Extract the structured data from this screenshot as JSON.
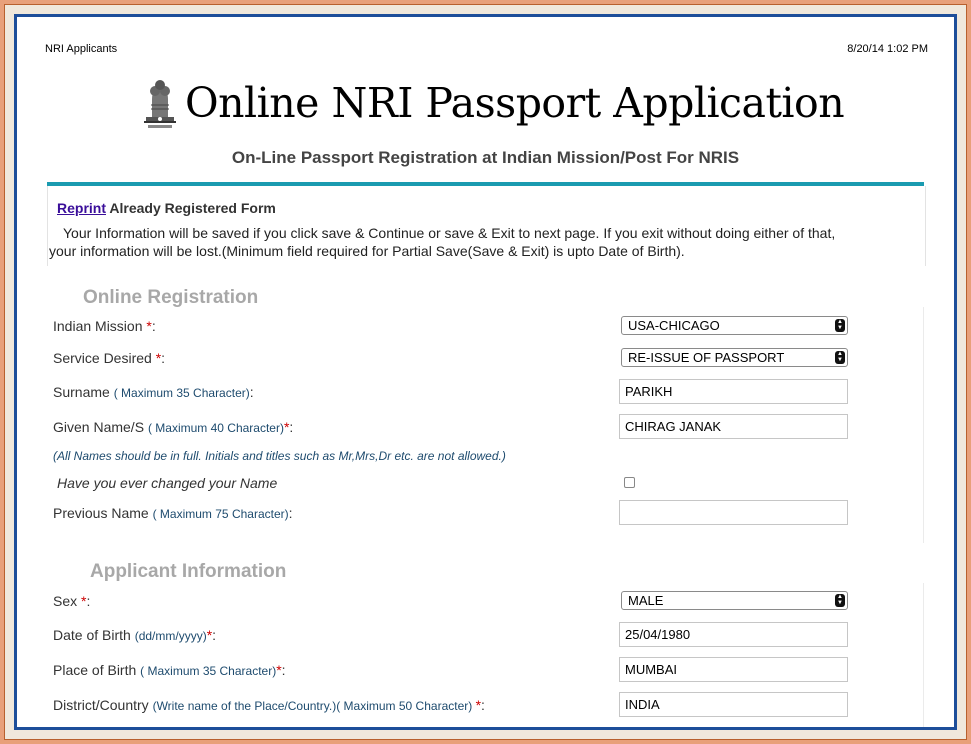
{
  "header": {
    "left": "NRI  Applicants",
    "right": "8/20/14 1:02 PM"
  },
  "title": "Online NRI Passport Application",
  "subtitle": "On-Line Passport Registration at Indian Mission/Post For NRIS",
  "reprint": {
    "link": "Reprint",
    "text": "Already Registered Form"
  },
  "info": {
    "line1": "Your Information will be saved if you click save & Continue or save & Exit to next page. If you exit without  doing either of that,",
    "line2": "your information will be lost.(Minimum field required for Partial Save(Save & Exit) is upto  Date of Birth)."
  },
  "online_registration": {
    "heading": "Online Registration",
    "indian_mission": {
      "label": "Indian Mission ",
      "req": "*",
      "suffix": ":",
      "value": "USA-CHICAGO"
    },
    "service_desired": {
      "label": "Service Desired ",
      "req": "*",
      "suffix": ":",
      "value": "RE-ISSUE OF PASSPORT"
    },
    "surname": {
      "label": "Surname ",
      "hint": "( Maximum 35 Character)",
      "suffix": ":",
      "value": "PARIKH"
    },
    "given_name": {
      "label": "Given Name/S ",
      "hint": "( Maximum 40 Character)",
      "req": "*",
      "suffix": ":",
      "value": "CHIRAG JANAK"
    },
    "note": "(All Names should be in full. Initials and titles such as Mr,Mrs,Dr etc. are not allowed.)",
    "changed_name": {
      "label": "Have you ever changed your Name",
      "checked": false
    },
    "previous_name": {
      "label": "Previous Name ",
      "hint": "( Maximum 75 Character)",
      "suffix": ":",
      "value": ""
    }
  },
  "applicant_information": {
    "heading": "Applicant Information",
    "sex": {
      "label": "Sex ",
      "req": "*",
      "suffix": ":",
      "value": "MALE"
    },
    "dob": {
      "label": "Date of Birth ",
      "hint": "(dd/mm/yyyy)",
      "req": "*",
      "suffix": ":",
      "value": "25/04/1980"
    },
    "place_of_birth": {
      "label": "Place of Birth ",
      "hint": "( Maximum 35 Character)",
      "req": "*",
      "suffix": ":",
      "value": "MUMBAI"
    },
    "district_country": {
      "label": "District/Country ",
      "hint": "(Write name of the Place/Country.)( Maximum 50 Character) ",
      "req": "*",
      "suffix": ":",
      "value": "INDIA"
    }
  },
  "colors": {
    "accent_teal": "#1a9bb0",
    "frame_blue": "#1d4e9a",
    "link_purple": "#3a0e9a",
    "required_red": "#cc0000"
  }
}
